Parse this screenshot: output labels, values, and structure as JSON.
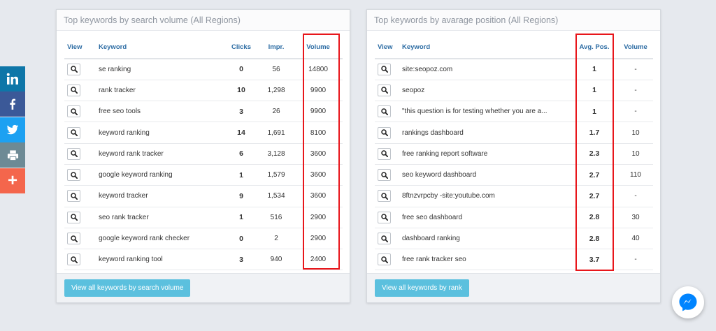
{
  "left_panel": {
    "title": "Top keywords by search volume (All Regions)",
    "columns": [
      "View",
      "Keyword",
      "Clicks",
      "Impr.",
      "Volume"
    ],
    "rows": [
      {
        "keyword": "se ranking",
        "clicks": "0",
        "impr": "56",
        "volume": "14800"
      },
      {
        "keyword": "rank tracker",
        "clicks": "10",
        "impr": "1,298",
        "volume": "9900"
      },
      {
        "keyword": "free seo tools",
        "clicks": "3",
        "impr": "26",
        "volume": "9900"
      },
      {
        "keyword": "keyword ranking",
        "clicks": "14",
        "impr": "1,691",
        "volume": "8100"
      },
      {
        "keyword": "keyword rank tracker",
        "clicks": "6",
        "impr": "3,128",
        "volume": "3600"
      },
      {
        "keyword": "google keyword ranking",
        "clicks": "1",
        "impr": "1,579",
        "volume": "3600"
      },
      {
        "keyword": "keyword tracker",
        "clicks": "9",
        "impr": "1,534",
        "volume": "3600"
      },
      {
        "keyword": "seo rank tracker",
        "clicks": "1",
        "impr": "516",
        "volume": "2900"
      },
      {
        "keyword": "google keyword rank checker",
        "clicks": "0",
        "impr": "2",
        "volume": "2900"
      },
      {
        "keyword": "keyword ranking tool",
        "clicks": "3",
        "impr": "940",
        "volume": "2400"
      }
    ],
    "button_label": "View all keywords by search volume"
  },
  "right_panel": {
    "title": "Top keywords by avarage position (All Regions)",
    "columns": [
      "View",
      "Keyword",
      "Avg. Pos.",
      "Volume"
    ],
    "rows": [
      {
        "keyword": "site:seopoz.com",
        "avg_pos": "1",
        "volume": "-"
      },
      {
        "keyword": "seopoz",
        "avg_pos": "1",
        "volume": "-"
      },
      {
        "keyword": "\"this question is for testing whether you are a...",
        "avg_pos": "1",
        "volume": "-"
      },
      {
        "keyword": "rankings dashboard",
        "avg_pos": "1.7",
        "volume": "10"
      },
      {
        "keyword": "free ranking report software",
        "avg_pos": "2.3",
        "volume": "10"
      },
      {
        "keyword": "seo keyword dashboard",
        "avg_pos": "2.7",
        "volume": "110"
      },
      {
        "keyword": "8ftnzvrpcby -site:youtube.com",
        "avg_pos": "2.7",
        "volume": "-"
      },
      {
        "keyword": "free seo dashboard",
        "avg_pos": "2.8",
        "volume": "30"
      },
      {
        "keyword": "dashboard ranking",
        "avg_pos": "2.8",
        "volume": "40"
      },
      {
        "keyword": "free rank tracker seo",
        "avg_pos": "3.7",
        "volume": "-"
      }
    ],
    "button_label": "View all keywords by rank"
  },
  "social_bar": [
    {
      "icon": "linkedin-icon",
      "glyph": "in",
      "color": "#0e76a8"
    },
    {
      "icon": "facebook-icon",
      "glyph": "f",
      "color": "#3b5998"
    },
    {
      "icon": "twitter-icon",
      "glyph": "twitter",
      "color": "#1da1f2"
    },
    {
      "icon": "print-icon",
      "glyph": "print",
      "color": "#6d8a95"
    },
    {
      "icon": "share-more-icon",
      "glyph": "+",
      "color": "#f4664c"
    }
  ],
  "colors": {
    "highlight": "#e8161b",
    "button": "#5bc0de",
    "header_text": "#2e6da4",
    "messenger": "#0084ff"
  }
}
